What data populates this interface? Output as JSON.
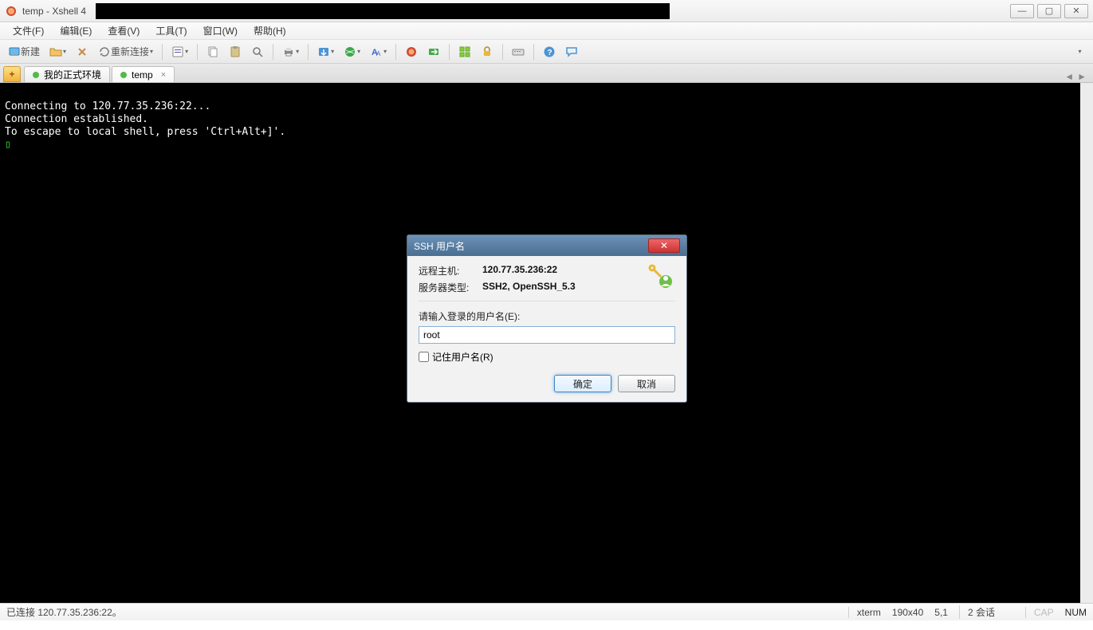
{
  "window": {
    "title": "temp - Xshell 4"
  },
  "menu": {
    "file": "文件(F)",
    "edit": "编辑(E)",
    "view": "查看(V)",
    "tool": "工具(T)",
    "window": "窗口(W)",
    "help": "帮助(H)"
  },
  "toolbar": {
    "newLabel": "新建",
    "reconnectLabel": "重新连接"
  },
  "tabs": {
    "first": "我的正式环境",
    "second": "temp"
  },
  "terminal": {
    "line1": "Connecting to 120.77.35.236:22...",
    "line2": "Connection established.",
    "line3": "To escape to local shell, press 'Ctrl+Alt+]'.",
    "cursor": "▯"
  },
  "dialog": {
    "title": "SSH 用户名",
    "remoteHostLabel": "远程主机:",
    "remoteHostValue": "120.77.35.236:22",
    "serverTypeLabel": "服务器类型:",
    "serverTypeValue": "SSH2, OpenSSH_5.3",
    "prompt": "请输入登录的用户名(E):",
    "usernameValue": "root",
    "rememberLabel": "记住用户名(R)",
    "okLabel": "确定",
    "cancelLabel": "取消"
  },
  "status": {
    "leftText": "已连接 120.77.35.236:22。",
    "termType": "xterm",
    "size": "190x40",
    "cursorPos": "5,1",
    "sessions": "2 会话",
    "cap": "CAP",
    "num": "NUM"
  }
}
